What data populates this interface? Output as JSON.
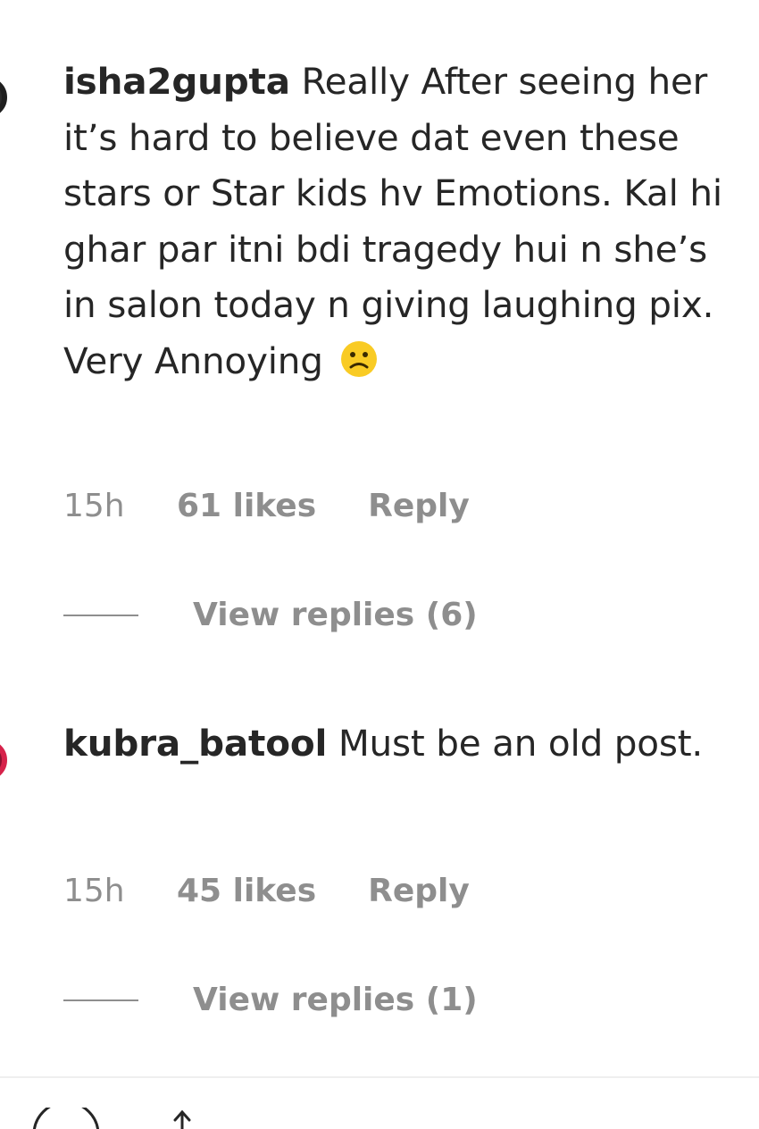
{
  "comments": [
    {
      "username": "isha2gupta",
      "text": "Really After seeing her it’s hard to believe dat even these stars or Star kids hv Emotions. Kal hi ghar par itni bdi tragedy hui n she’s in salon today n giving laughing pix. Very Annoying",
      "emoji": "frowning-face-emoji",
      "time": "15h",
      "likes": "61 likes",
      "reply_label": "Reply",
      "view_replies": "View replies (6)"
    },
    {
      "username": "kubra_batool",
      "text": "Must be an old post.",
      "time": "15h",
      "likes": "45 likes",
      "reply_label": "Reply",
      "view_replies": "View replies (1)"
    }
  ],
  "colors": {
    "text_primary": "#262626",
    "text_secondary": "#8e8e8e",
    "divider": "#efefef",
    "emoji_yellow": "#f9cb24"
  }
}
